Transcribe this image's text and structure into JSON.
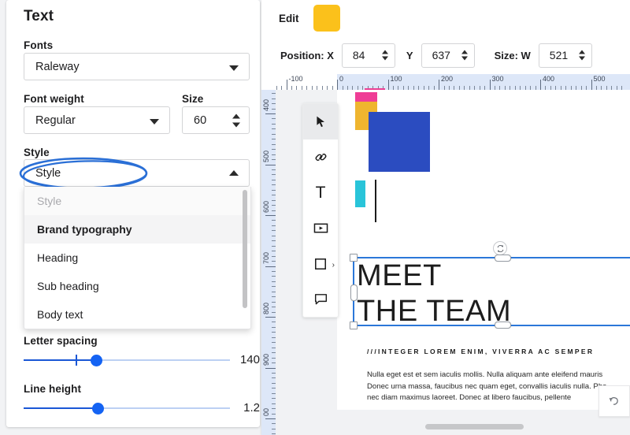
{
  "left_panel": {
    "title": "Text",
    "fonts": {
      "label": "Fonts",
      "value": "Raleway",
      "icon": "chevron-down-icon"
    },
    "font_weight": {
      "label": "Font weight",
      "value": "Regular",
      "icon": "chevron-down-icon"
    },
    "size": {
      "label": "Size",
      "value": "60",
      "icon": "spinner-icon"
    },
    "style": {
      "label": "Style",
      "value": "Style",
      "icon": "chevron-up-icon",
      "expanded": true,
      "options": [
        {
          "label": "Style",
          "state": "placeholder"
        },
        {
          "label": "Brand typography",
          "state": "selected"
        },
        {
          "label": "Heading",
          "state": "normal"
        },
        {
          "label": "Sub heading",
          "state": "normal"
        },
        {
          "label": "Body text",
          "state": "normal"
        }
      ]
    },
    "letter_spacing": {
      "label": "Letter spacing",
      "value": "140",
      "fill_percent": 35,
      "tick_percent": 25
    },
    "line_height": {
      "label": "Line height",
      "value": "1.2",
      "fill_percent": 36
    },
    "annotation": {
      "shape": "hand-drawn-ellipse",
      "color": "#2a6fd6"
    }
  },
  "right_panel": {
    "edit_bar": {
      "label": "Edit",
      "swatch_color": "#fbc11b"
    },
    "properties": {
      "position_label": "Position: X",
      "x_value": "84",
      "y_label": "Y",
      "y_value": "637",
      "size_label": "Size: W",
      "w_value": "521"
    },
    "ruler": {
      "horizontal_labels": [
        "-100",
        "0",
        "100",
        "200",
        "300",
        "400",
        "500"
      ],
      "vertical_labels": [
        "400",
        "500",
        "600",
        "700",
        "800",
        "900",
        "00"
      ],
      "selection_marker_color": "#ec3f94"
    },
    "toolbar": [
      {
        "name": "select-tool",
        "glyph": "cursor",
        "active": true
      },
      {
        "name": "link-tool",
        "glyph": "link",
        "active": false
      },
      {
        "name": "text-tool",
        "glyph": "T",
        "active": false
      },
      {
        "name": "media-tool",
        "glyph": "video",
        "active": false
      },
      {
        "name": "shape-tool",
        "glyph": "square",
        "active": false,
        "has_submenu": true
      },
      {
        "name": "comment-tool",
        "glyph": "comment",
        "active": false
      }
    ],
    "canvas": {
      "shapes": [
        {
          "name": "pink-bar",
          "color": "#ef3d96"
        },
        {
          "name": "yellow-block",
          "color": "#efb52f"
        },
        {
          "name": "blue-block",
          "color": "#2b4cc0"
        },
        {
          "name": "cyan-bar",
          "color": "#29c4d9"
        },
        {
          "name": "black-rule",
          "color": "#1c1c1c"
        }
      ],
      "headline": "MEET\nTHE TEAM",
      "eyebrow": "///INTEGER LOREM ENIM, VIVERRA AC SEMPER",
      "body": "Nulla eget est et sem iaculis mollis. Nulla aliquam ante eleifend mauris\nDonec urna massa, faucibus nec quam eget, convallis iaculis nulla. Pha\nnec diam maximus laoreet. Donec at libero faucibus, pellente",
      "selection": {
        "color": "#2b77d9",
        "rotate_icon": "rotate-icon"
      },
      "undo_icon": "undo-icon"
    }
  }
}
